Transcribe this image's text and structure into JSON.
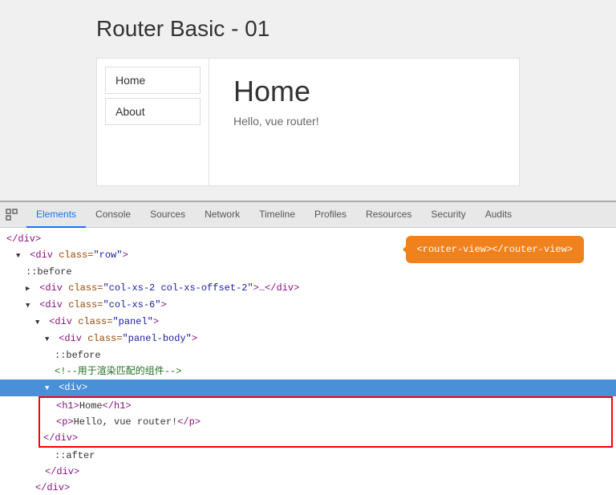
{
  "page": {
    "title": "Router Basic - 01"
  },
  "nav": {
    "links": [
      {
        "label": "Home",
        "active": true
      },
      {
        "label": "About",
        "active": false
      }
    ]
  },
  "content": {
    "heading": "Home",
    "text": "Hello, vue router!"
  },
  "devtools": {
    "tabs": [
      {
        "label": "Elements",
        "active": true
      },
      {
        "label": "Console",
        "active": false
      },
      {
        "label": "Sources",
        "active": false
      },
      {
        "label": "Network",
        "active": false
      },
      {
        "label": "Timeline",
        "active": false
      },
      {
        "label": "Profiles",
        "active": false
      },
      {
        "label": "Resources",
        "active": false
      },
      {
        "label": "Security",
        "active": false
      },
      {
        "label": "Audits",
        "active": false
      }
    ],
    "tooltip": "<router-view></router-view>",
    "code_lines": [
      {
        "indent": 0,
        "text": "</div>",
        "type": "normal"
      },
      {
        "indent": 0,
        "text": "<div class=\"row\">",
        "type": "normal",
        "triangle": "▼"
      },
      {
        "indent": 1,
        "text": "::before",
        "type": "pseudo"
      },
      {
        "indent": 1,
        "text": "<div class=\"col-xs-2 col-xs-offset-2\">…</div>",
        "type": "normal",
        "triangle": "▶"
      },
      {
        "indent": 1,
        "text": "<div class=\"col-xs-6\">",
        "type": "normal",
        "triangle": "▼"
      },
      {
        "indent": 2,
        "text": "<div class=\"panel\">",
        "type": "normal",
        "triangle": "▼"
      },
      {
        "indent": 3,
        "text": "<div class=\"panel-body\">",
        "type": "normal",
        "triangle": "▼"
      },
      {
        "indent": 4,
        "text": "::before",
        "type": "pseudo"
      },
      {
        "indent": 4,
        "text": "<!--用于渲染匹配的组件-->",
        "type": "comment"
      },
      {
        "indent": 4,
        "text": "<div>",
        "type": "highlighted",
        "triangle": "▼"
      },
      {
        "indent": 5,
        "text": "<h1>Home</h1>",
        "type": "selected"
      },
      {
        "indent": 5,
        "text": "<p>Hello, vue router!</p>",
        "type": "selected"
      },
      {
        "indent": 4,
        "text": "</div>",
        "type": "selected"
      },
      {
        "indent": 4,
        "text": "::after",
        "type": "pseudo"
      },
      {
        "indent": 3,
        "text": "</div>",
        "type": "normal"
      },
      {
        "indent": 2,
        "text": "</div>",
        "type": "normal"
      }
    ]
  }
}
